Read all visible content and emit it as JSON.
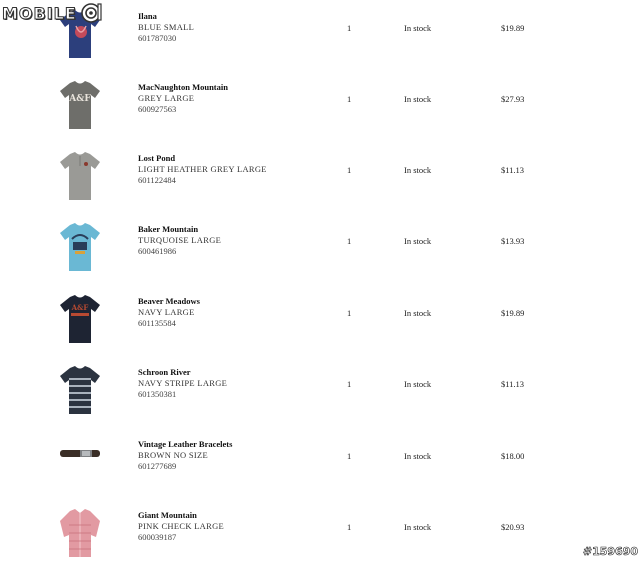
{
  "watermark": {
    "brand": "MOBILE"
  },
  "items": [
    {
      "name": "Ilana",
      "variant": "BLUE SMALL",
      "sku": "601787030",
      "qty": "1",
      "stock": "In stock",
      "price": "$19.89",
      "icon": "navy-tshirt-icon",
      "color": "#2c3f7c"
    },
    {
      "name": "MacNaughton Mountain",
      "variant": "GREY LARGE",
      "sku": "600927563",
      "qty": "1",
      "stock": "In stock",
      "price": "$27.93",
      "icon": "grey-tshirt-icon",
      "color": "#6e6e6a"
    },
    {
      "name": "Lost Pond",
      "variant": "LIGHT HEATHER GREY LARGE",
      "sku": "601122484",
      "qty": "1",
      "stock": "In stock",
      "price": "$11.13",
      "icon": "heather-grey-henley-icon",
      "color": "#9a9a96"
    },
    {
      "name": "Baker Mountain",
      "variant": "TURQUOISE LARGE",
      "sku": "600461986",
      "qty": "1",
      "stock": "In stock",
      "price": "$13.93",
      "icon": "turquoise-tshirt-icon",
      "color": "#6ab8d4"
    },
    {
      "name": "Beaver Meadows",
      "variant": "NAVY LARGE",
      "sku": "601135584",
      "qty": "1",
      "stock": "In stock",
      "price": "$19.89",
      "icon": "navy-tshirt-icon",
      "color": "#1e2433"
    },
    {
      "name": "Schroon River",
      "variant": "NAVY STRIPE LARGE",
      "sku": "601350381",
      "qty": "1",
      "stock": "In stock",
      "price": "$11.13",
      "icon": "striped-polo-icon",
      "color": "#2b3340"
    },
    {
      "name": "Vintage Leather Bracelets",
      "variant": "BROWN NO SIZE",
      "sku": "601277689",
      "qty": "1",
      "stock": "In stock",
      "price": "$18.00",
      "icon": "leather-bracelet-icon",
      "color": "#3a2e26"
    },
    {
      "name": "Giant Mountain",
      "variant": "PINK CHECK LARGE",
      "sku": "600039187",
      "qty": "1",
      "stock": "In stock",
      "price": "$20.93",
      "icon": "pink-check-shirt-icon",
      "color": "#e29aa2"
    }
  ],
  "stamp": "#159690"
}
